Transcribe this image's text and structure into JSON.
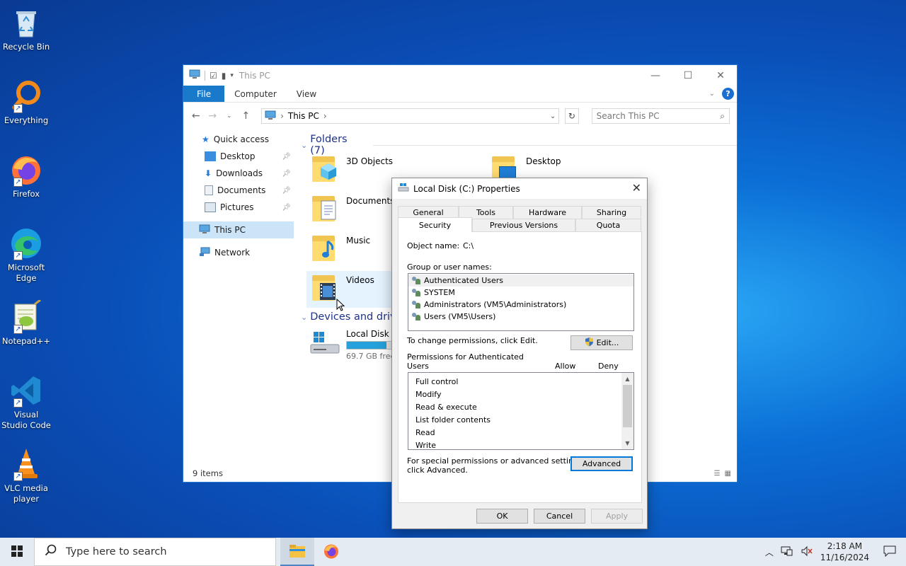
{
  "desktop": {
    "icons": [
      {
        "label": "Recycle Bin",
        "icon": "recycle-bin-icon"
      },
      {
        "label": "Everything",
        "icon": "everything-search-icon"
      },
      {
        "label": "Firefox",
        "icon": "firefox-icon"
      },
      {
        "label": "Microsoft Edge",
        "icon": "edge-icon"
      },
      {
        "label": "Notepad++",
        "icon": "notepadpp-icon"
      },
      {
        "label": "Visual Studio Code",
        "icon": "vscode-icon"
      },
      {
        "label": "VLC media player",
        "icon": "vlc-icon"
      }
    ]
  },
  "explorer": {
    "title": "This PC",
    "ribbon": {
      "file": "File",
      "computer": "Computer",
      "view": "View"
    },
    "address": {
      "path": "This PC"
    },
    "search": {
      "placeholder": "Search This PC"
    },
    "nav": {
      "quick_access": "Quick access",
      "desktop": "Desktop",
      "downloads": "Downloads",
      "documents": "Documents",
      "pictures": "Pictures",
      "this_pc": "This PC",
      "network": "Network"
    },
    "folders_header": "Folders (7)",
    "folders": {
      "objects3d": "3D Objects",
      "desktop": "Desktop",
      "documents": "Documents",
      "music": "Music",
      "videos": "Videos"
    },
    "devices_header": "Devices and drives",
    "drive": {
      "name": "Local Disk (C:)",
      "free": "69.7 GB free",
      "used_fraction": 0.52
    },
    "status": "9 items"
  },
  "props": {
    "title": "Local Disk (C:) Properties",
    "tabs_top": [
      "General",
      "Tools",
      "Hardware",
      "Sharing"
    ],
    "tabs_bottom": [
      "Security",
      "Previous Versions",
      "Quota"
    ],
    "object_name_label": "Object name:",
    "object_name_value": "C:\\",
    "group_label": "Group or user names:",
    "users": [
      "Authenticated Users",
      "SYSTEM",
      "Administrators (VM5\\Administrators)",
      "Users (VM5\\Users)"
    ],
    "change_text": "To change permissions, click Edit.",
    "edit_button": "Edit...",
    "perm_for_line1": "Permissions for Authenticated",
    "perm_for_line2": "Users",
    "allow": "Allow",
    "deny": "Deny",
    "permissions": [
      "Full control",
      "Modify",
      "Read & execute",
      "List folder contents",
      "Read",
      "Write"
    ],
    "special_line1": "For special permissions or advanced settings,",
    "special_line2": "click Advanced.",
    "advanced_button": "Advanced",
    "ok": "OK",
    "cancel": "Cancel",
    "apply": "Apply"
  },
  "taskbar": {
    "search_placeholder": "Type here to search",
    "time": "2:18 AM",
    "date": "11/16/2024"
  }
}
